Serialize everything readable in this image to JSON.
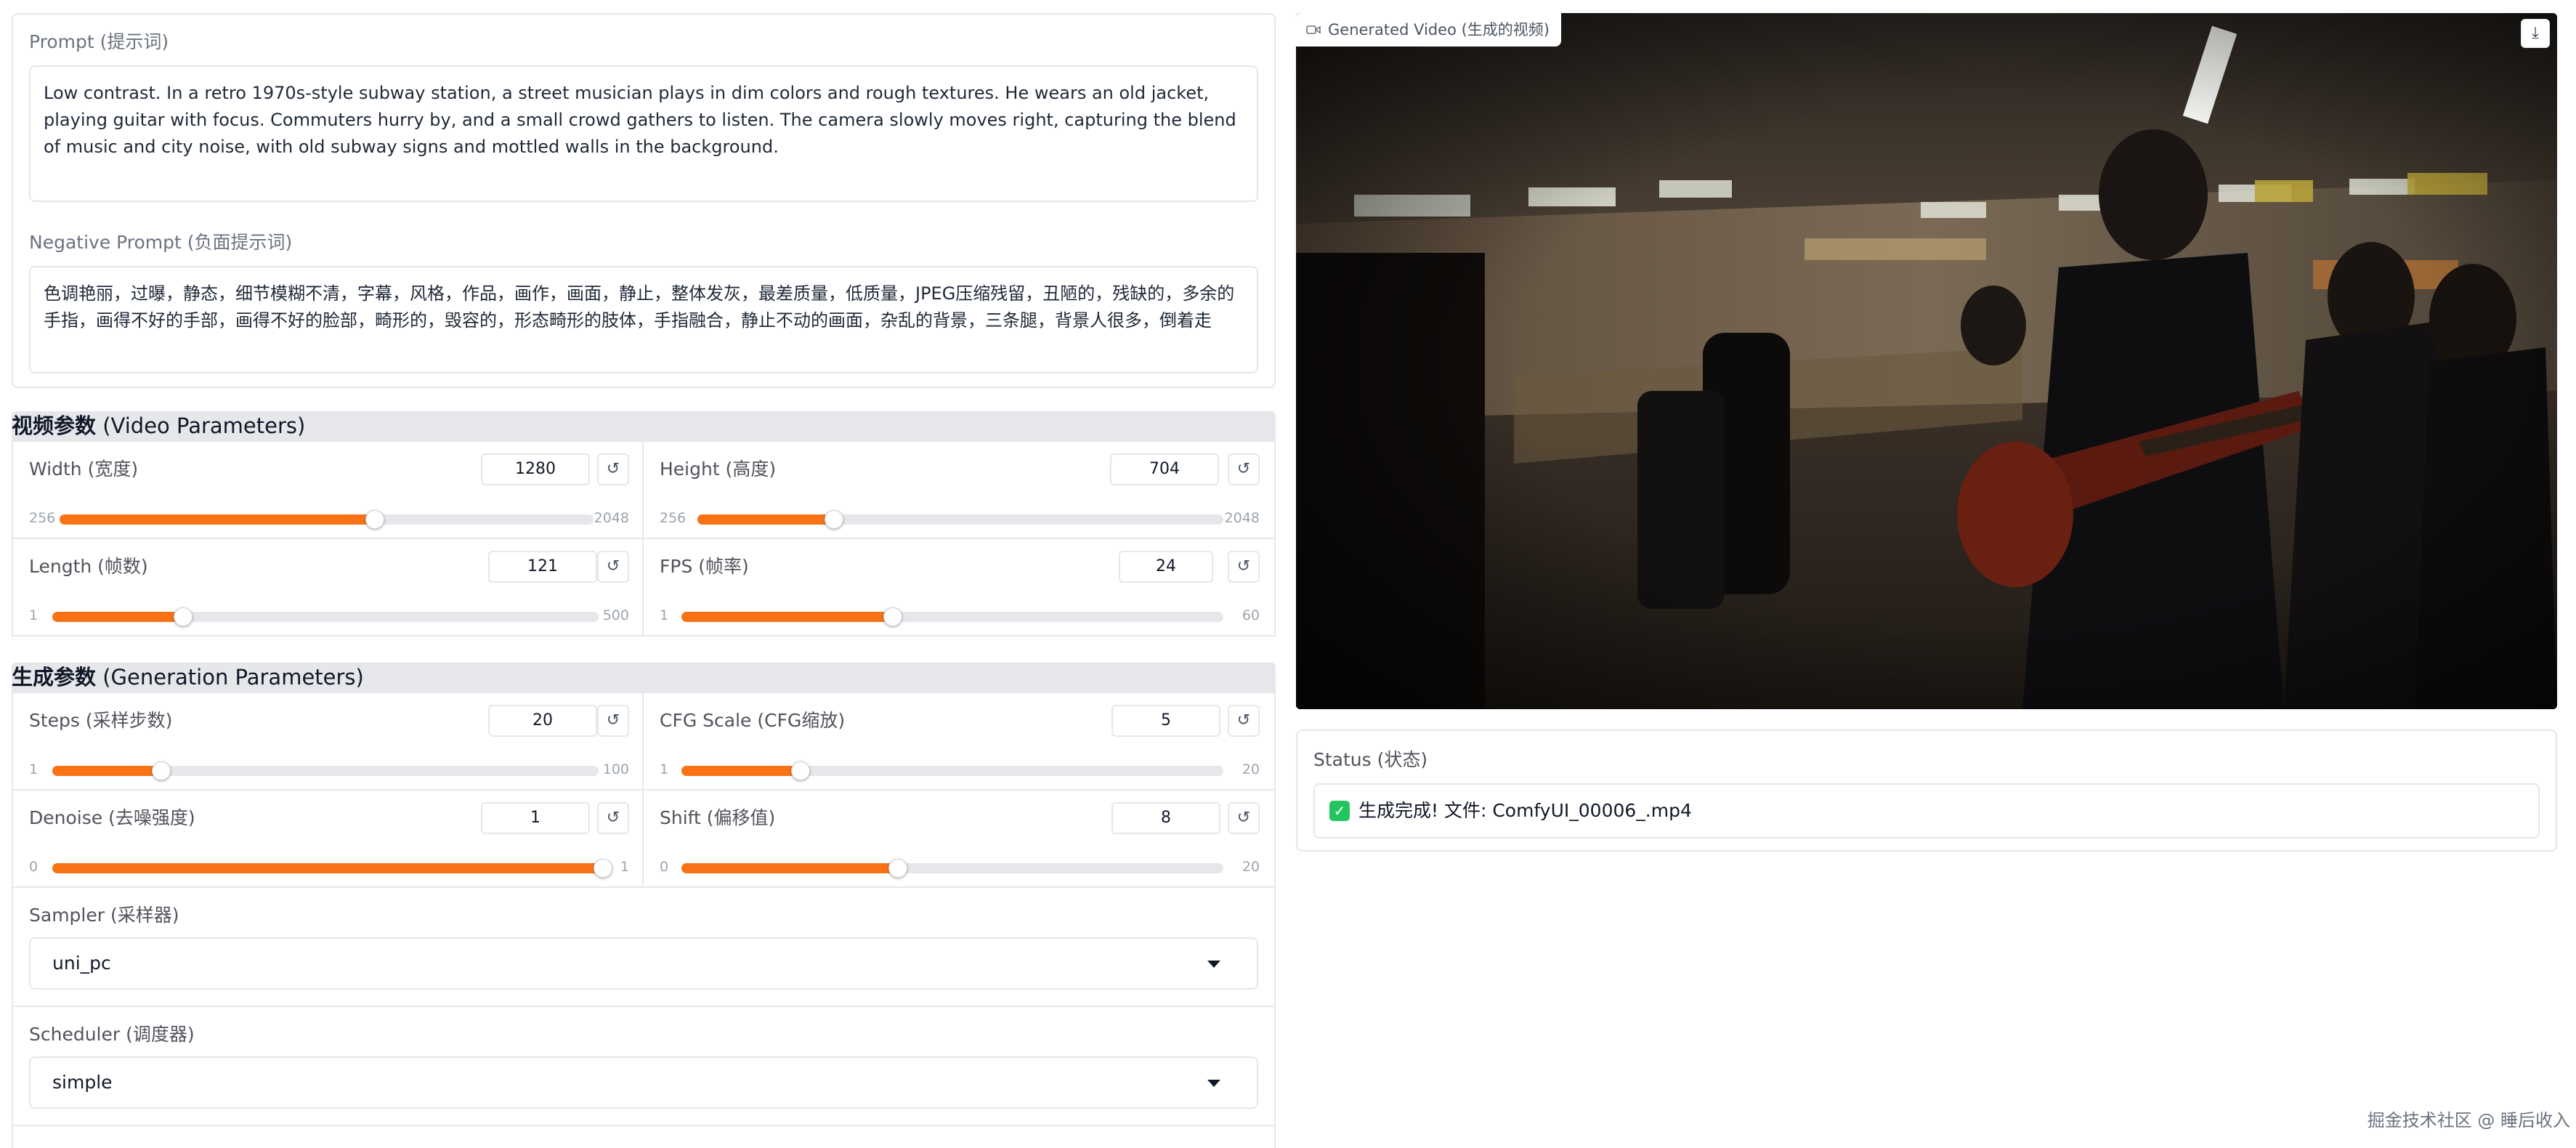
{
  "prompt": {
    "label": "Prompt (提示词)",
    "value": "Low contrast. In a retro 1970s-style subway station, a street musician plays in dim colors and rough textures. He wears an old jacket, playing guitar with focus. Commuters hurry by, and a small crowd gathers to listen. The camera slowly moves right, capturing the blend of music and city noise, with old subway signs and mottled walls in the background."
  },
  "negative_prompt": {
    "label": "Negative Prompt (负面提示词)",
    "value": "色调艳丽，过曝，静态，细节模糊不清，字幕，风格，作品，画作，画面，静止，整体发灰，最差质量，低质量，JPEG压缩残留，丑陋的，残缺的，多余的手指，画得不好的手部，画得不好的脸部，畸形的，毁容的，形态畸形的肢体，手指融合，静止不动的画面，杂乱的背景，三条腿，背景人很多，倒着走"
  },
  "video_params": {
    "header_cn": "视频参数",
    "header_en": " (Video Parameters)",
    "width": {
      "label": "Width (宽度)",
      "value": "1280",
      "min": "256",
      "max": "2048",
      "fraction": 0.59
    },
    "height": {
      "label": "Height (高度)",
      "value": "704",
      "min": "256",
      "max": "2048",
      "fraction": 0.26
    },
    "length": {
      "label": "Length (帧数)",
      "value": "121",
      "min": "1",
      "max": "500",
      "fraction": 0.24
    },
    "fps": {
      "label": "FPS (帧率)",
      "value": "24",
      "min": "1",
      "max": "60",
      "fraction": 0.39
    }
  },
  "gen_params": {
    "header_cn": "生成参数",
    "header_en": " (Generation Parameters)",
    "steps": {
      "label": "Steps (采样步数)",
      "value": "20",
      "min": "1",
      "max": "100",
      "fraction": 0.2
    },
    "cfg": {
      "label": "CFG Scale (CFG缩放)",
      "value": "5",
      "min": "1",
      "max": "20",
      "fraction": 0.22
    },
    "denoise": {
      "label": "Denoise (去噪强度)",
      "value": "1",
      "min": "0",
      "max": "1",
      "fraction": 1.0
    },
    "shift": {
      "label": "Shift (偏移值)",
      "value": "8",
      "min": "0",
      "max": "20",
      "fraction": 0.4
    }
  },
  "sampler": {
    "label": "Sampler (采样器)",
    "value": "uni_pc"
  },
  "scheduler": {
    "label": "Scheduler (调度器)",
    "value": "simple"
  },
  "controls": {
    "reset_glyph": "↺",
    "download_glyph": "⤓"
  },
  "video": {
    "label": "Generated Video (生成的视频)",
    "icon": "video-camera-icon"
  },
  "status": {
    "label": "Status (状态)",
    "icon": "check-mark-icon",
    "message": "生成完成! 文件: ComfyUI_00006_.mp4"
  },
  "watermark": "掘金技术社区 @ 睡后收入",
  "colors": {
    "accent": "#f97316",
    "border": "#e5e7eb",
    "header_bg": "#e5e7eb",
    "check": "#22c55e"
  }
}
